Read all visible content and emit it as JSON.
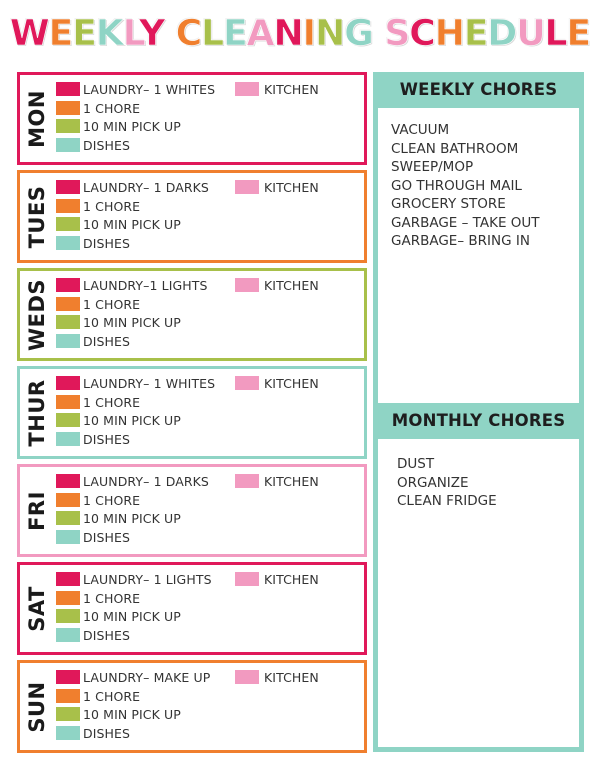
{
  "title": {
    "text": "WEEKLY CLEANING SCHEDULE",
    "letter_colors": [
      "#e0185a",
      "#f07f2e",
      "#a8c04a",
      "#8fd4c5",
      "#f29ac0"
    ]
  },
  "colors": {
    "laundry": "#e0185a",
    "chore": "#f07f2e",
    "pickup": "#a8c04a",
    "dishes": "#8fd4c5",
    "kitchen": "#f29ac0",
    "panel": "#8fd4c5"
  },
  "days": [
    {
      "label": "MON",
      "border": "#e0185a",
      "laundry": "LAUNDRY– 1 WHITES",
      "chore": "1 CHORE",
      "pickup": "10 MIN PICK UP",
      "dishes": "DISHES",
      "kitchen": "KITCHEN"
    },
    {
      "label": "TUES",
      "border": "#f07f2e",
      "laundry": "LAUNDRY– 1 DARKS",
      "chore": "1 CHORE",
      "pickup": "10 MIN PICK UP",
      "dishes": "DISHES",
      "kitchen": "KITCHEN"
    },
    {
      "label": "WEDS",
      "border": "#a8c04a",
      "laundry": "LAUNDRY–1 LIGHTS",
      "chore": "1 CHORE",
      "pickup": "10 MIN PICK UP",
      "dishes": "DISHES",
      "kitchen": "KITCHEN"
    },
    {
      "label": "THUR",
      "border": "#8fd4c5",
      "laundry": "LAUNDRY– 1 WHITES",
      "chore": "1 CHORE",
      "pickup": "10 MIN PICK UP",
      "dishes": "DISHES",
      "kitchen": "KITCHEN"
    },
    {
      "label": "FRI",
      "border": "#f29ac0",
      "laundry": "LAUNDRY– 1 DARKS",
      "chore": "1 CHORE",
      "pickup": "10 MIN PICK UP",
      "dishes": "DISHES",
      "kitchen": "KITCHEN"
    },
    {
      "label": "SAT",
      "border": "#e0185a",
      "laundry": "LAUNDRY– 1 LIGHTS",
      "chore": "1 CHORE",
      "pickup": "10 MIN PICK UP",
      "dishes": "DISHES",
      "kitchen": "KITCHEN"
    },
    {
      "label": "SUN",
      "border": "#f07f2e",
      "laundry": "LAUNDRY– MAKE UP",
      "chore": "1 CHORE",
      "pickup": "10 MIN PICK UP",
      "dishes": "DISHES",
      "kitchen": "KITCHEN"
    }
  ],
  "weekly": {
    "title": "WEEKLY CHORES",
    "items": [
      "VACUUM",
      "CLEAN BATHROOM",
      "SWEEP/MOP",
      "GO THROUGH MAIL",
      "GROCERY STORE",
      "GARBAGE – TAKE OUT",
      "GARBAGE– BRING IN"
    ]
  },
  "monthly": {
    "title": "MONTHLY CHORES",
    "items": [
      "DUST",
      "ORGANIZE",
      "CLEAN FRIDGE"
    ]
  }
}
